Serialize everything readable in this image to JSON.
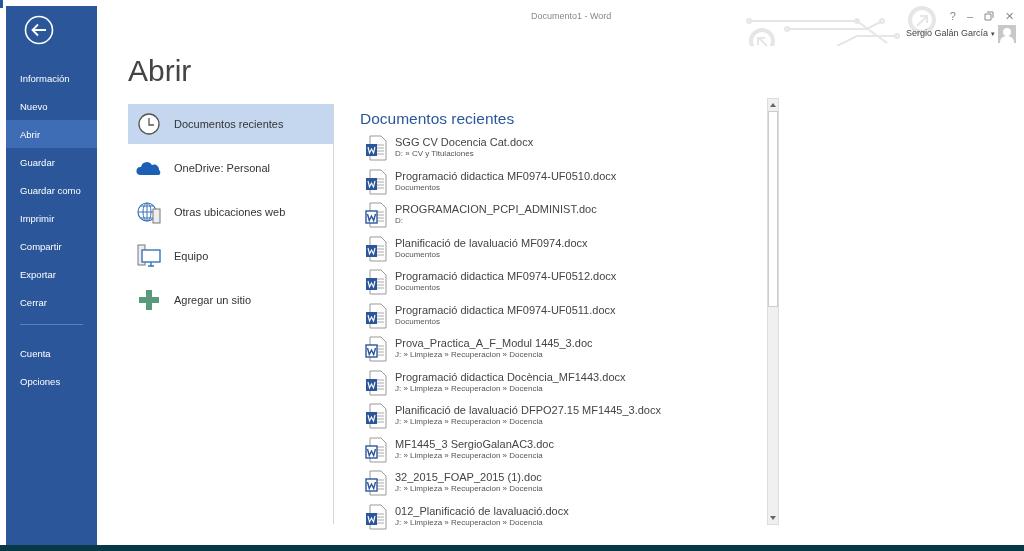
{
  "window": {
    "title": "Documento1 - Word",
    "controls": [
      "?",
      "–",
      "✕"
    ]
  },
  "account": {
    "user": "Sergio Galán García",
    "caret": "▾"
  },
  "sidebar": {
    "items": [
      {
        "label": "Información",
        "selected": false
      },
      {
        "label": "Nuevo",
        "selected": false
      },
      {
        "label": "Abrir",
        "selected": true
      },
      {
        "label": "Guardar",
        "selected": false
      },
      {
        "label": "Guardar como",
        "selected": false
      },
      {
        "label": "Imprimir",
        "selected": false
      },
      {
        "label": "Compartir",
        "selected": false
      },
      {
        "label": "Exportar",
        "selected": false
      },
      {
        "label": "Cerrar",
        "selected": false,
        "divider_after": true
      },
      {
        "label": "Cuenta",
        "selected": false
      },
      {
        "label": "Opciones",
        "selected": false
      }
    ]
  },
  "page_title": "Abrir",
  "places": [
    {
      "kind": "clock",
      "label": "Documentos recientes",
      "selected": true
    },
    {
      "kind": "cloud",
      "label": "OneDrive: Personal",
      "selected": false
    },
    {
      "kind": "globe",
      "label": "Otras ubicaciones web",
      "selected": false
    },
    {
      "kind": "computer",
      "label": "Equipo",
      "selected": false
    },
    {
      "kind": "plus",
      "label": "Agregar un sitio",
      "selected": false
    }
  ],
  "recent": {
    "title": "Documentos recientes",
    "files": [
      {
        "kind": "docx",
        "name": "SGG CV Docencia Cat.docx",
        "path": "D: » CV y Titulaciones"
      },
      {
        "kind": "docx",
        "name": "Programació didactica MF0974-UF0510.docx",
        "path": "Documentos"
      },
      {
        "kind": "doc",
        "name": "PROGRAMACION_PCPI_ADMINIST.doc",
        "path": "D:"
      },
      {
        "kind": "docx",
        "name": "Planificació de lavaluació MF0974.docx",
        "path": "Documentos"
      },
      {
        "kind": "docx",
        "name": "Programació didactica MF0974-UF0512.docx",
        "path": "Documentos"
      },
      {
        "kind": "docx",
        "name": "Programació didactica MF0974-UF0511.docx",
        "path": "Documentos"
      },
      {
        "kind": "doc",
        "name": "Prova_Practica_A_F_Modul 1445_3.doc",
        "path": "J: » Limpieza » Recuperacion » Docencia"
      },
      {
        "kind": "docx",
        "name": "Programació didactica Docència_MF1443.docx",
        "path": "J: » Limpieza » Recuperacion » Docencia"
      },
      {
        "kind": "docx",
        "name": "Planificació de lavaluació DFPO27.15 MF1445_3.docx",
        "path": "J: » Limpieza » Recuperacion » Docencia"
      },
      {
        "kind": "doc",
        "name": "MF1445_3 SergioGalanAC3.doc",
        "path": "J: » Limpieza » Recuperacion » Docencia"
      },
      {
        "kind": "doc",
        "name": "32_2015_FOAP_2015 (1).doc",
        "path": "J: » Limpieza » Recuperacion » Docencia"
      },
      {
        "kind": "docx",
        "name": "012_Planificació de lavaluació.docx",
        "path": "J: » Limpieza » Recuperacion » Docencia"
      }
    ]
  }
}
